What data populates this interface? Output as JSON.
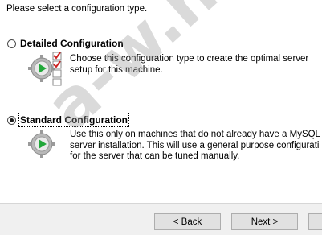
{
  "prompt": "Please select a configuration type.",
  "options": [
    {
      "label": "Detailed Configuration",
      "selected": false,
      "description": [
        "Choose this configuration type to create the optimal server",
        "setup for this machine."
      ]
    },
    {
      "label": "Standard Configuration",
      "selected": true,
      "description": [
        "Use this only on machines that do not already have a MySQL",
        "server installation. This will use a general purpose configurati",
        "for the server that can be tuned manually."
      ]
    }
  ],
  "buttons": {
    "back": "< Back",
    "next": "Next >"
  },
  "watermark": "a-w.net",
  "colors": {
    "play": "#22a83a",
    "check": "#cc2222",
    "footer_bg": "#f0f0f0",
    "button_bg": "#e1e1e1"
  }
}
